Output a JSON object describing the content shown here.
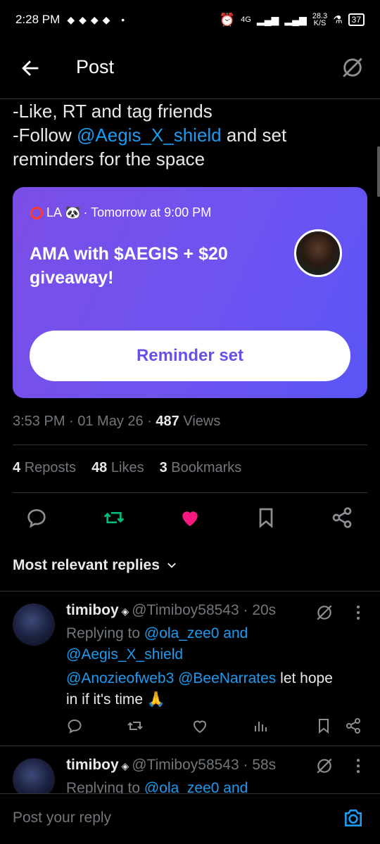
{
  "status_bar": {
    "time": "2:28 PM",
    "net_speed": "28.3",
    "net_unit": "K/S",
    "signal": "4G",
    "battery": "37"
  },
  "header": {
    "title": "Post"
  },
  "tweet": {
    "line1": "-Like, RT and tag friends",
    "line2_prefix": "-Follow ",
    "line2_link": "@Aegis_X_shield",
    "line2_suffix": " and set",
    "line3": "reminders for the space"
  },
  "space": {
    "host": "LA",
    "time": "· Tomorrow at 9:00 PM",
    "title": "AMA with $AEGIS + $20 giveaway!",
    "button": "Reminder set"
  },
  "meta": {
    "time": "3:53 PM · 01 May 26 · ",
    "views_count": "487",
    "views_label": " Views"
  },
  "stats": {
    "reposts_count": "4",
    "reposts_label": "Reposts",
    "likes_count": "48",
    "likes_label": "Likes",
    "bookmarks_count": "3",
    "bookmarks_label": "Bookmarks"
  },
  "replies_header": "Most relevant replies",
  "replies": [
    {
      "name": "timiboy",
      "handle": "@Timiboy58543 · 20s",
      "replying_prefix": "Replying to ",
      "replying_1": "@ola_zee0",
      "replying_and": " and",
      "replying_2": "@Aegis_X_shield",
      "mention_1": "@Anozieofweb3",
      "mention_2": "@BeeNarrates",
      "text_rest": " let hope",
      "text_line2": "in if it's time 🙏"
    },
    {
      "name": "timiboy",
      "handle": "@Timiboy58543 · 58s",
      "replying_prefix": "Replying to ",
      "replying_1": "@ola_zee0",
      "replying_and": " and"
    }
  ],
  "composer": {
    "placeholder": "Post your reply"
  },
  "colors": {
    "accent": "#1d9bf0",
    "like": "#f91880",
    "repost": "#00ba7c",
    "space_start": "#7b4ee6",
    "space_end": "#5a55f6"
  }
}
